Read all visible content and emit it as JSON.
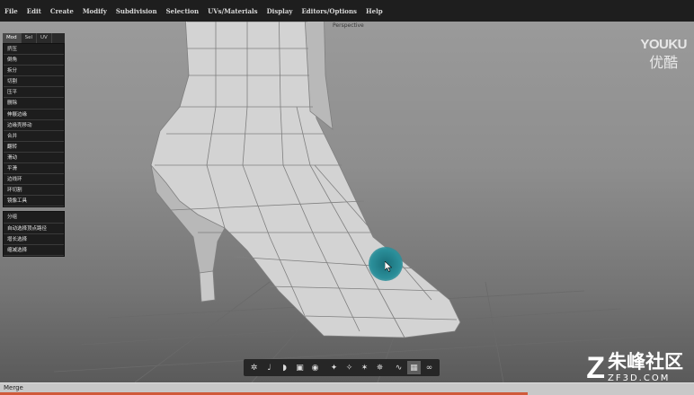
{
  "menubar": [
    "File",
    "Edit",
    "Create",
    "Modify",
    "Subdivision",
    "Selection",
    "UVs/Materials",
    "Display",
    "Editors/Options",
    "Help"
  ],
  "viewport": {
    "label": "Perspective"
  },
  "panel": {
    "tabs": [
      "Mod",
      "Sel",
      "UV"
    ],
    "tools": [
      "挤压",
      "倒角",
      "拆分",
      "切割",
      "压平",
      "删除",
      "伸展边缘",
      "边缘壳移动",
      "合并",
      "翻转",
      "滑动",
      "平滑",
      "边线环",
      "环切割",
      "镜像工具"
    ],
    "select_tools": [
      "分组",
      "自动选择顶点路径",
      "增长选择",
      "缩减选择"
    ]
  },
  "watermark": {
    "en": "YOUKU",
    "cn": "优酷"
  },
  "toolbar": {
    "icons": [
      "tool-a-icon",
      "tool-b-icon",
      "tool-c-icon",
      "cube-icon",
      "sphere-icon",
      "vertex-icon",
      "edge-icon",
      "face-icon",
      "object-icon",
      "curve-icon",
      "grid-icon",
      "link-icon"
    ],
    "active_index": 10
  },
  "logo": {
    "cn": "朱峰社区",
    "url": "ZF3D.COM"
  },
  "status": {
    "text": "Merge"
  },
  "progress": {
    "percent": 76
  },
  "colors": {
    "accent": "#2b8f9a",
    "progress": "#d05a3a"
  }
}
